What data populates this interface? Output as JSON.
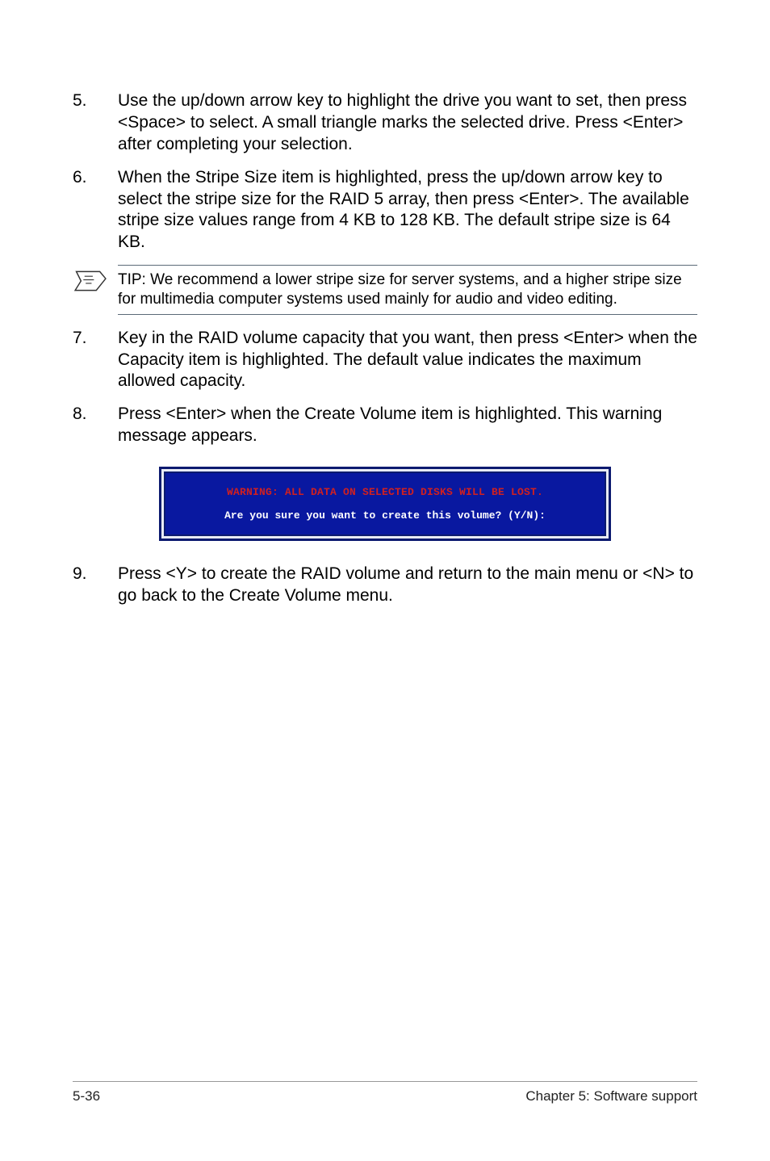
{
  "items": [
    {
      "num": "5.",
      "text": "Use the up/down arrow key to highlight the drive you want to set, then press <Space> to select.  A small triangle marks the selected drive. Press <Enter> after completing your selection."
    },
    {
      "num": "6.",
      "text": "When the Stripe Size item is highlighted, press the up/down arrow key to select the stripe size for the RAID 5 array, then press <Enter>. The available stripe size values range from 4 KB to 128 KB. The default stripe size is 64 KB."
    }
  ],
  "tip": "TIP: We recommend a lower stripe size for server systems, and a higher stripe size for multimedia computer systems used mainly for audio and video editing.",
  "items2": [
    {
      "num": "7.",
      "text": "Key in the RAID volume capacity that you want, then press <Enter> when the Capacity item is highlighted. The default value indicates the maximum allowed capacity."
    },
    {
      "num": "8.",
      "text": "Press <Enter> when the Create Volume item is highlighted. This warning message appears."
    }
  ],
  "terminal": {
    "warning": "WARNING: ALL DATA ON SELECTED DISKS WILL BE LOST.",
    "prompt": "Are you sure you want to create this volume? (Y/N):"
  },
  "items3": [
    {
      "num": "9.",
      "text": "Press <Y> to create the RAID volume and return to the main menu or <N> to go back to the Create Volume menu."
    }
  ],
  "footer": {
    "left": "5-36",
    "right": "Chapter 5: Software support"
  }
}
